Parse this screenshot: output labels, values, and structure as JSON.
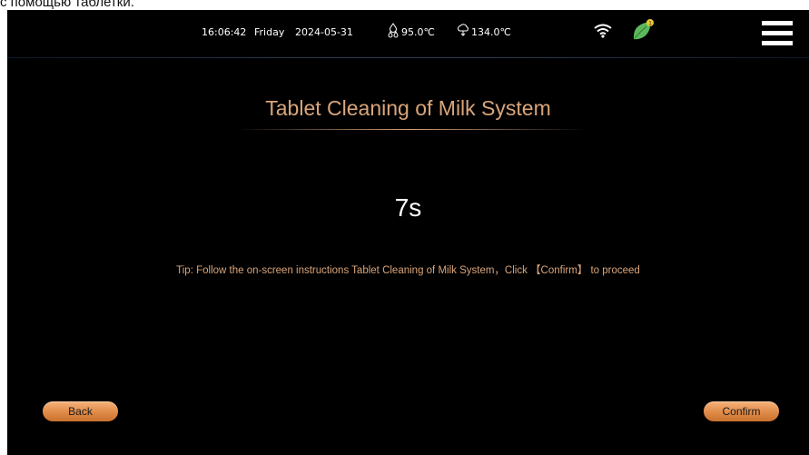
{
  "caption": "с помощью таблетки.",
  "status_bar": {
    "time": "16:06:42",
    "day": "Friday",
    "date": "2024-05-31",
    "boiler_temp": "95.0℃",
    "steam_temp": "134.0℃",
    "icons": {
      "boiler": "water-drops-icon",
      "steam": "cloud-icon",
      "wifi": "wifi-icon",
      "eco": "leaf-icon",
      "menu": "hamburger-menu-icon"
    },
    "eco_badge": "1"
  },
  "main": {
    "title": "Tablet Cleaning of Milk System",
    "countdown": "7s",
    "tip": "Tip: Follow the on-screen instructions Tablet Cleaning of Milk System，Click 【Confirm】 to proceed"
  },
  "buttons": {
    "back_label": "Back",
    "confirm_label": "Confirm"
  },
  "colors": {
    "accent": "#d9a57a",
    "button": "#e08a48",
    "background": "#000000",
    "eco_green": "#5cb85c"
  }
}
